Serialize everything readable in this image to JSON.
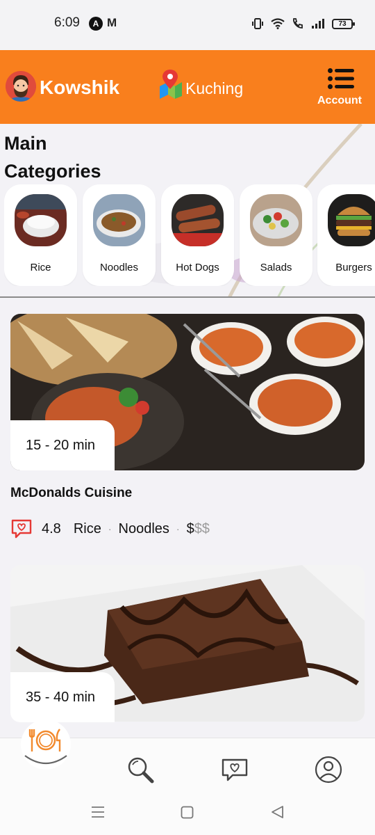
{
  "status_bar": {
    "time": "6:09",
    "app_icon_a": "A",
    "app_icon_m": "M",
    "battery": "73"
  },
  "header": {
    "user_name": "Kowshik",
    "location": "Kuching",
    "menu_label": "Account",
    "background_color": "#f97f1d"
  },
  "categories": {
    "title": "Main Categories",
    "items": [
      {
        "label": "Rice",
        "icon": "rice-bowl"
      },
      {
        "label": "Noodles",
        "icon": "noodles-plate"
      },
      {
        "label": "Hot Dogs",
        "icon": "sausages"
      },
      {
        "label": "Salads",
        "icon": "salad-bowl"
      },
      {
        "label": "Burgers",
        "icon": "burger"
      }
    ]
  },
  "restaurants": [
    {
      "eta": "15 - 20 min",
      "name": "McDonalds Cuisine",
      "rating": "4.8",
      "tags": [
        "Rice",
        "Noodles"
      ],
      "price_active": "$",
      "price_inactive": "$$",
      "image": "curry-bowls-naan"
    },
    {
      "eta": "35 - 40 min",
      "image": "chocolate-brownie"
    }
  ],
  "bottom_nav": {
    "items": [
      "restaurant-icon",
      "search-icon",
      "favorites-icon",
      "profile-icon"
    ],
    "active": "restaurant-icon",
    "accent_color": "#f28a2e"
  }
}
